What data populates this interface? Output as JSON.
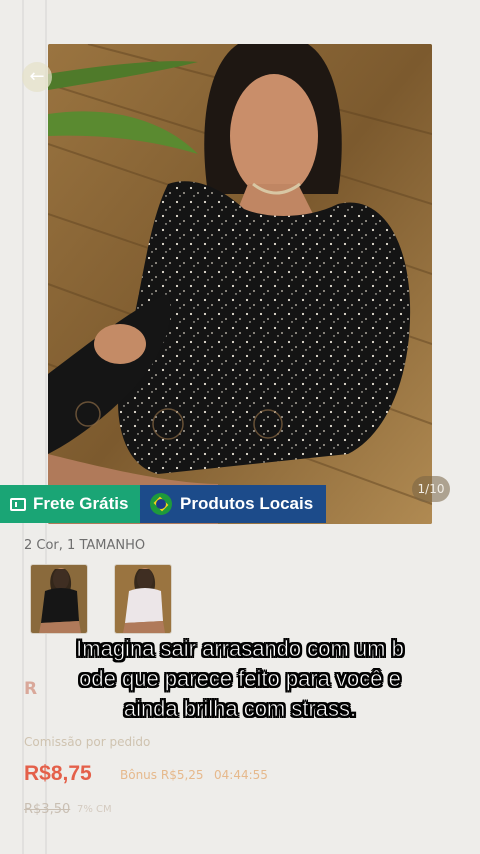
{
  "product": {
    "image_counter": "1/10",
    "badges": {
      "shipping": "Frete Grátis",
      "local": "Produtos Locais"
    },
    "variants_text": "2 Cor, 1 TAMANHO",
    "price_partial": "R",
    "commission_label": "Comissão por pedido",
    "commission_value": "R$8,75",
    "bonus": "Bônus R$5,25",
    "timer": "04:44:55",
    "old_price": "R$3,50",
    "discount": "7% CM"
  },
  "caption": {
    "line1": "Imagina sair arrasando com um b",
    "line2": "ode que parece feito para você e",
    "line3": "ainda brilha com strass."
  },
  "icons": {
    "back": "arrow-left-icon",
    "shipping": "ticket-icon",
    "local": "brazil-flag-icon"
  },
  "colors": {
    "shipping_badge": "#1aa575",
    "local_badge": "#1c4b8a",
    "price": "#e4604a"
  }
}
